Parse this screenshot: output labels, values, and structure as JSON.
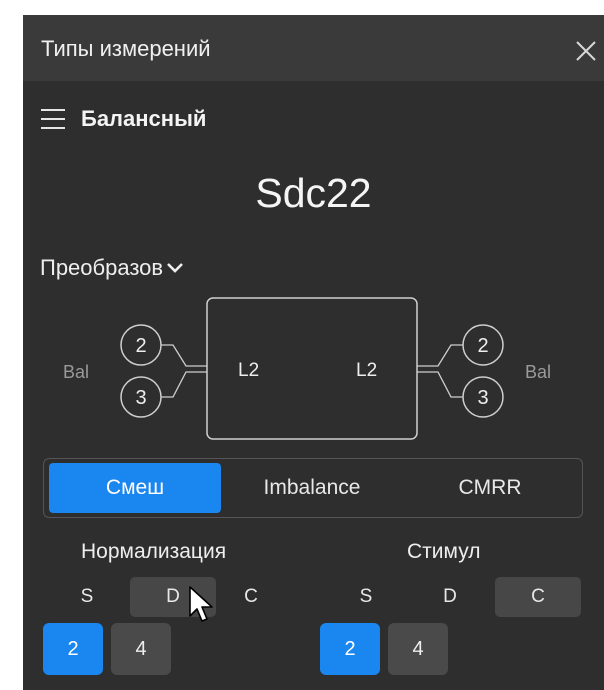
{
  "window": {
    "title": "Типы измерений"
  },
  "header": {
    "section": "Балансный"
  },
  "parameter": {
    "name": "Sdc22"
  },
  "type_dropdown": {
    "value": "Преобразов"
  },
  "diagram": {
    "left": {
      "ports": [
        "2",
        "3"
      ],
      "label": "Bal",
      "logical": "L2"
    },
    "right": {
      "ports": [
        "2",
        "3"
      ],
      "label": "Bal",
      "logical": "L2"
    }
  },
  "modes": {
    "items": [
      "Смеш",
      "Imbalance",
      "CMRR"
    ],
    "selected": "Смеш"
  },
  "normalization": {
    "title": "Нормализация",
    "options": [
      "S",
      "D",
      "C"
    ],
    "selected": "D",
    "values": [
      "2",
      "4"
    ],
    "selected_value": "2"
  },
  "stimulus": {
    "title": "Стимул",
    "options": [
      "S",
      "D",
      "C"
    ],
    "selected": "C",
    "values": [
      "2",
      "4"
    ],
    "selected_value": "2"
  },
  "colors": {
    "accent": "#1a86f0",
    "panel": "#2e2e2e",
    "header": "#3a3a3a"
  }
}
